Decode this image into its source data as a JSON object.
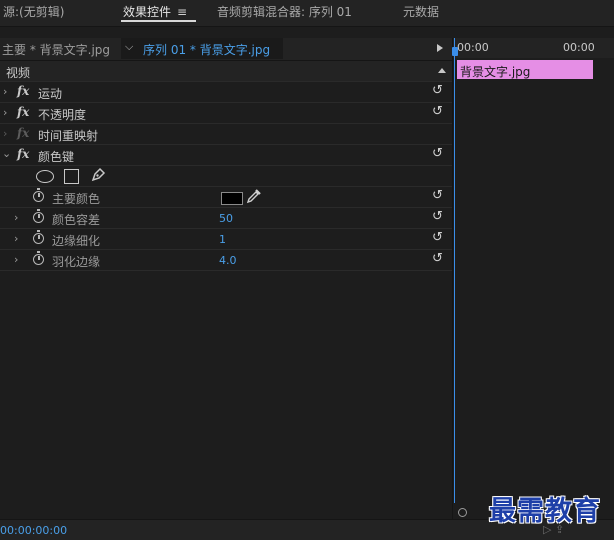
{
  "tabs": [
    {
      "label": "源:(无剪辑)"
    },
    {
      "label": "效果控件"
    },
    {
      "label": "音频剪辑混合器: 序列 01"
    },
    {
      "label": "元数据"
    }
  ],
  "menu_icon": "≡",
  "source": {
    "master_label": "主要 * 背景文字.jpg",
    "sequence_label": "序列 01 * 背景文字.jpg"
  },
  "section": {
    "video_label": "视频"
  },
  "effects": [
    {
      "label": "运动"
    },
    {
      "label": "不透明度"
    },
    {
      "label": "时间重映射"
    },
    {
      "label": "颜色键"
    }
  ],
  "properties": [
    {
      "label": "主要颜色",
      "value": ""
    },
    {
      "label": "颜色容差",
      "value": "50"
    },
    {
      "label": "边缘细化",
      "value": "1"
    },
    {
      "label": "羽化边缘",
      "value": "4.0"
    }
  ],
  "fx_label": "fx",
  "reset_glyph": "↺",
  "timeline": {
    "tc_start": "00:00",
    "tc_end": "00:00",
    "clip_label": "背景文字.jpg"
  },
  "status": {
    "timecode": "00:00:00:00"
  },
  "watermark": "最需教育",
  "colors": {
    "accent": "#4a9fe8",
    "clip": "#e58ee5",
    "key_color": "#000000"
  }
}
